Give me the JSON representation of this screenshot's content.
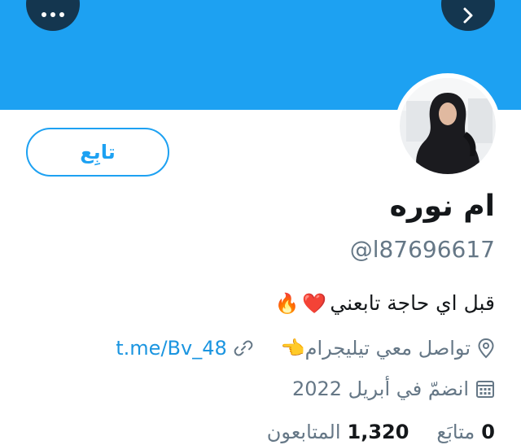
{
  "colors": {
    "banner": "#1da1f2",
    "accent": "#1da1f2",
    "link": "#1b95e0",
    "muted": "#657786"
  },
  "header": {
    "more_icon": "ellipsis-icon",
    "back_icon": "chevron-right-icon"
  },
  "profile": {
    "follow_label": "تابِع",
    "display_name": "ام نوره",
    "handle": "@l87696617",
    "bio_text": "قبل اي حاجة تابعني",
    "bio_emojis": [
      "❤️",
      "🔥"
    ],
    "location_text": "تواصل معي تيليجرام👈",
    "link_text": "t.me/Bv_48",
    "joined_text": "انضمّ في أبريل 2022"
  },
  "stats": {
    "following_count": "0",
    "following_label": "متابَع",
    "followers_count": "1,320",
    "followers_label": "المتابعون"
  }
}
